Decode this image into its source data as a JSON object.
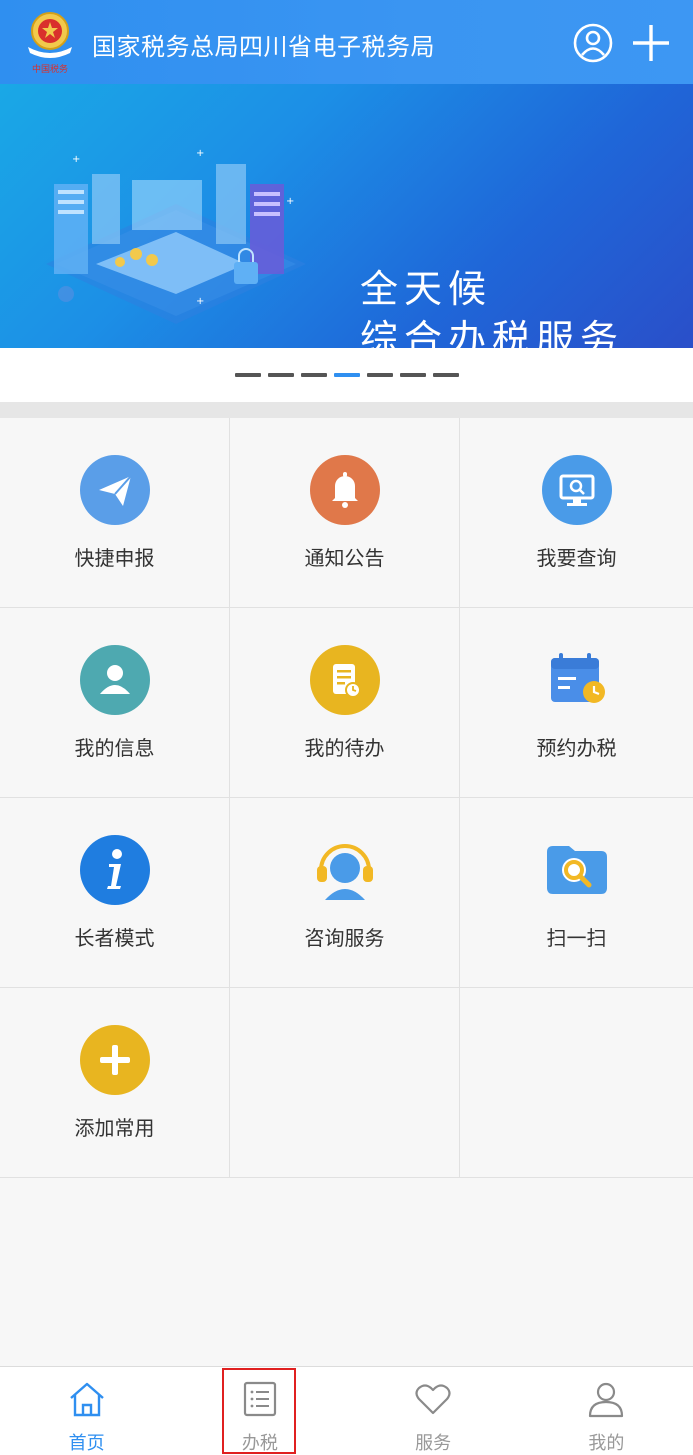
{
  "header": {
    "title": "国家税务总局四川省电子税务局",
    "logo_icon": "tax-emblem-icon",
    "user_icon": "user-circle-icon",
    "plus_icon": "plus-icon"
  },
  "banner": {
    "line1": "全天候",
    "line2": "综合办税服务"
  },
  "pager": {
    "count": 7,
    "active_index": 3
  },
  "grid": {
    "items": [
      {
        "label": "快捷申报",
        "icon": "paper-plane-icon",
        "color": "#5a9ee8"
      },
      {
        "label": "通知公告",
        "icon": "bell-icon",
        "color": "#e0784a"
      },
      {
        "label": "我要查询",
        "icon": "monitor-search-icon",
        "color": "#4a9be8"
      },
      {
        "label": "我的信息",
        "icon": "person-icon",
        "color": "#4ea9b0"
      },
      {
        "label": "我的待办",
        "icon": "todo-document-icon",
        "color": "#e8b520"
      },
      {
        "label": "预约办税",
        "icon": "calendar-clock-icon",
        "color": "#4a8ee8"
      },
      {
        "label": "长者模式",
        "icon": "info-icon",
        "color": "#1f7de0"
      },
      {
        "label": "咨询服务",
        "icon": "headset-icon",
        "color": "#4a9be8"
      },
      {
        "label": "扫一扫",
        "icon": "scan-magnifier-icon",
        "color": "#4a9be8"
      },
      {
        "label": "添加常用",
        "icon": "add-icon",
        "color": "#e8b520"
      }
    ]
  },
  "bottom_nav": {
    "items": [
      {
        "label": "首页",
        "icon": "home-icon",
        "active": true
      },
      {
        "label": "办税",
        "icon": "list-icon",
        "active": false
      },
      {
        "label": "服务",
        "icon": "heart-icon",
        "active": false
      },
      {
        "label": "我的",
        "icon": "user-icon",
        "active": false
      }
    ]
  },
  "colors": {
    "header": "#2f8ff0",
    "accent": "#2f8ff0",
    "highlight": "#e02020"
  }
}
